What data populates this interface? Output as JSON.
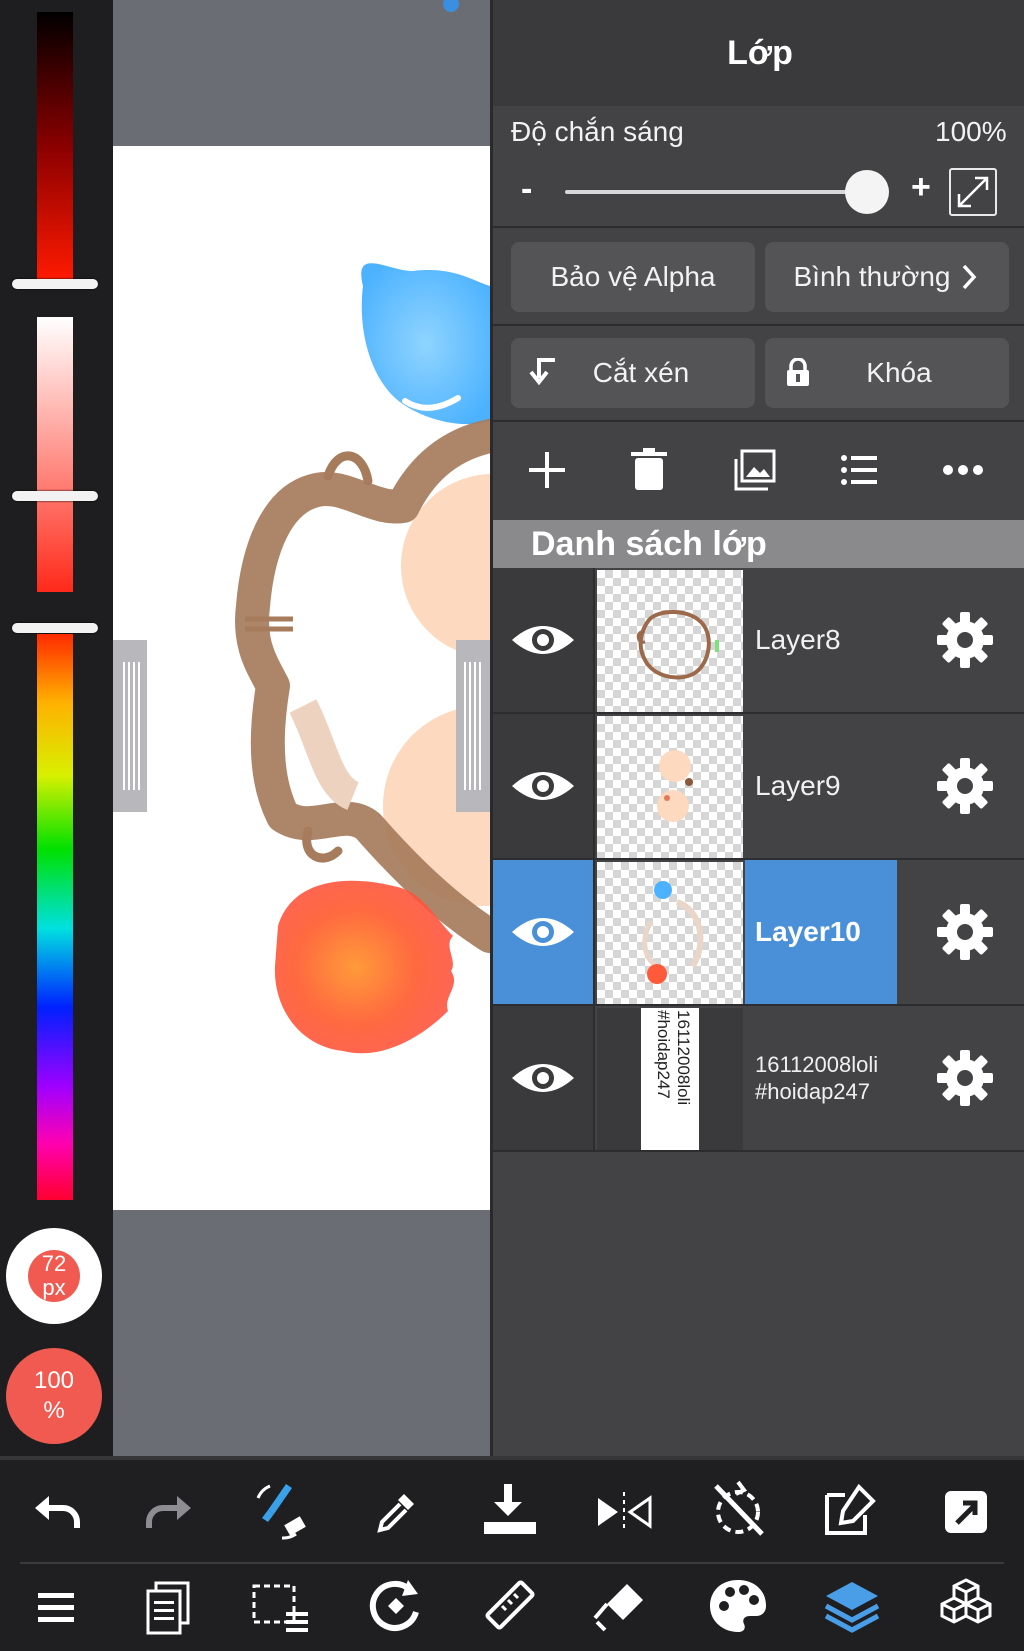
{
  "panel": {
    "title": "Lớp",
    "opacity_label": "Độ chắn sáng",
    "opacity_value": "100%",
    "opacity_minus": "-",
    "opacity_plus": "+",
    "alpha_protect_label": "Bảo vệ Alpha",
    "blend_mode_label": "Bình thường",
    "clip_label": "Cắt xén",
    "lock_label": "Khóa",
    "list_header": "Danh sách lớp"
  },
  "layers": [
    {
      "name": "Layer8",
      "visible": true,
      "selected": false
    },
    {
      "name": "Layer9",
      "visible": true,
      "selected": false
    },
    {
      "name": "Layer10",
      "visible": true,
      "selected": true
    },
    {
      "name_line1": "16112008loli",
      "name_line2": "#hoidap247",
      "visible": true,
      "selected": false
    }
  ],
  "thumb_text": {
    "line1": "16112008loli",
    "line2": "#hoidap247"
  },
  "brush": {
    "size_value": "72",
    "size_unit": "px",
    "opacity_value": "100",
    "opacity_unit": "%"
  },
  "colors": {
    "accent": "#4a90d9",
    "brush_red": "#f05a50"
  },
  "toolbar_top": [
    "undo-icon",
    "redo-icon",
    "brush-swap-icon",
    "eyedropper-icon",
    "import-icon",
    "flip-icon",
    "rotate-off-icon",
    "edit-icon",
    "share-icon"
  ],
  "toolbar_bottom": [
    "menu-icon",
    "pages-icon",
    "selection-icon",
    "transform-icon",
    "ruler-icon",
    "fill-icon",
    "palette-icon",
    "layers-icon",
    "3d-icon"
  ]
}
